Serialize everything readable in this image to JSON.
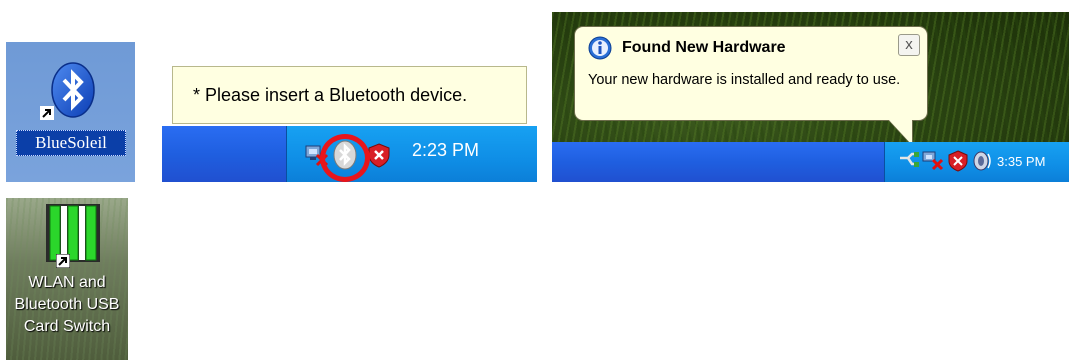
{
  "desktop_icon_bluesoleil": {
    "label": "BlueSoleil",
    "icon": "bluetooth-icon"
  },
  "taskbar_balloon_1": {
    "message": "* Please insert a Bluetooth device.",
    "clock": "2:23 PM",
    "tray_icons": [
      "network-disconnected-icon",
      "bluetooth-tray-icon",
      "security-shield-icon"
    ],
    "highlight_color": "#e8151b"
  },
  "taskbar_balloon_2": {
    "title": "Found New Hardware",
    "message": "Your new hardware is installed and ready to use.",
    "close_label": "x",
    "clock": "3:35 PM",
    "tray_icons": [
      "safely-remove-hardware-icon",
      "network-disconnected-icon",
      "security-shield-icon",
      "volume-icon"
    ]
  },
  "desktop_icon_switch": {
    "label_line1": "WLAN and",
    "label_line2": "Bluetooth USB",
    "label_line3": "Card Switch",
    "icon": "card-switch-icon",
    "bar_color": "#2bd62b"
  },
  "colors": {
    "taskbar_blue": "#2a6df2",
    "tray_blue": "#17a1f2",
    "balloon_yellow": "#ffffe1",
    "bluetooth_blue": "#1a5fd8"
  }
}
